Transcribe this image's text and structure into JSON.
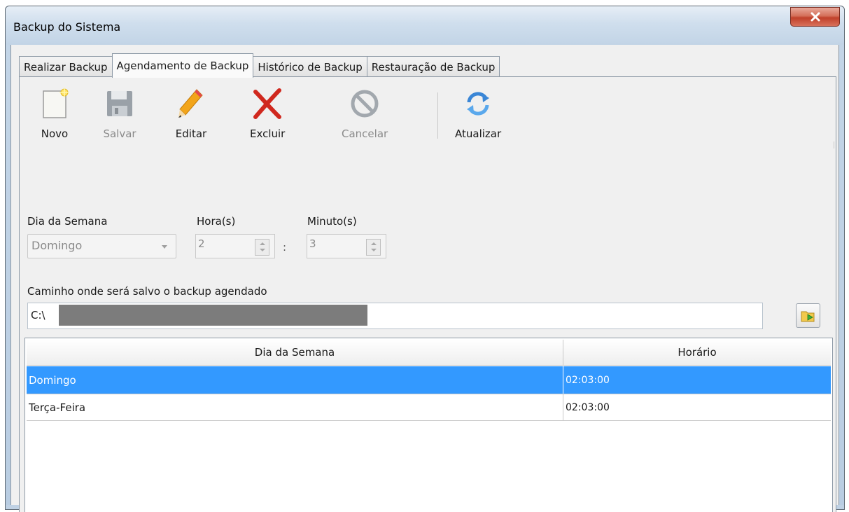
{
  "window": {
    "title": "Backup do Sistema",
    "close_label": "x"
  },
  "tabs": [
    {
      "label": "Realizar Backup",
      "active": false
    },
    {
      "label": "Agendamento de Backup",
      "active": true
    },
    {
      "label": "Histórico de Backup",
      "active": false
    },
    {
      "label": "Restauração de Backup",
      "active": false
    }
  ],
  "toolbar": {
    "novo": "Novo",
    "salvar": "Salvar",
    "editar": "Editar",
    "excluir": "Excluir",
    "cancelar": "Cancelar",
    "atualizar": "Atualizar"
  },
  "form": {
    "dia_label": "Dia da Semana",
    "dia_value": "Domingo",
    "hora_label": "Hora(s)",
    "hora_value": "2",
    "minuto_label": "Minuto(s)",
    "minuto_value": "3",
    "separator": ":",
    "path_label": "Caminho onde será salvo o backup agendado",
    "path_value": "C:\\"
  },
  "grid": {
    "columns": [
      "Dia da Semana",
      "Horário"
    ],
    "rows": [
      {
        "dia": "Domingo",
        "horario": "02:03:00",
        "selected": true
      },
      {
        "dia": "Terça-Feira",
        "horario": "02:03:00",
        "selected": false
      }
    ]
  },
  "colors": {
    "selection": "#3399ff",
    "delete_red": "#d0281e",
    "refresh_blue": "#3a86d6"
  },
  "icons": {
    "novo": "new-document-icon",
    "salvar": "floppy-disk-icon",
    "editar": "pencil-icon",
    "excluir": "red-x-icon",
    "cancelar": "prohibited-icon",
    "atualizar": "refresh-icon",
    "browse": "folder-arrow-icon"
  }
}
